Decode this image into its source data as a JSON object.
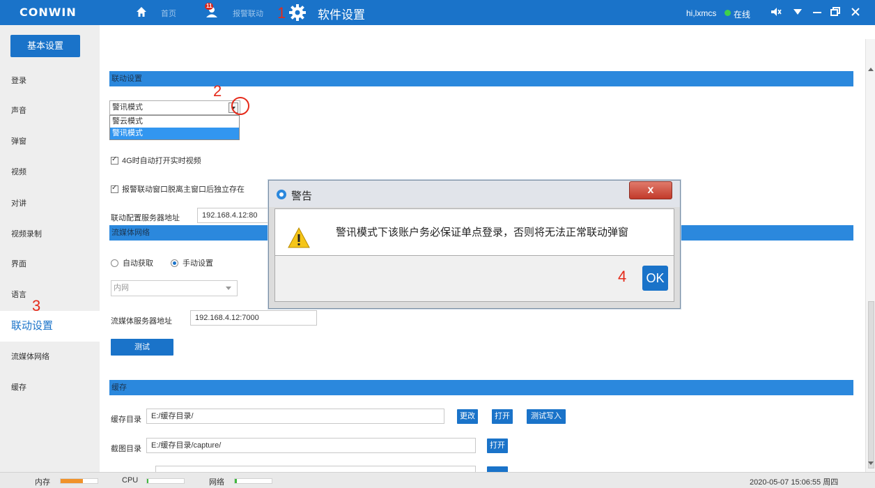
{
  "titlebar": {
    "logo": "CONWIN",
    "nav": {
      "home_label": "首页",
      "alarm_label": "报警联动",
      "alarm_badge": "11",
      "settings_label": "软件设置"
    },
    "user": "hi,lxmcs",
    "status": "在线"
  },
  "leftnav": {
    "basic_button": "基本设置",
    "items": [
      "登录",
      "声音",
      "弹窗",
      "视频",
      "对讲",
      "视频录制",
      "界面",
      "语言",
      "联动设置",
      "流媒体网络",
      "缓存"
    ],
    "active_index": 8
  },
  "linkage": {
    "section_title": "联动设置",
    "mode_select": "警讯模式",
    "mode_options": [
      "警云模式",
      "警讯模式"
    ],
    "selected_option": "警讯模式",
    "check_4g": "4G时自动打开实时视频",
    "check_detach": "报警联动窗口脱离主窗口后独立存在",
    "server_label": "联动配置服务器地址",
    "server_value": "192.168.4.12:80"
  },
  "streaming": {
    "section_title": "流媒体网络",
    "radio_auto": "自动获取",
    "radio_manual": "手动设置",
    "network_select": "内网",
    "server_label": "流媒体服务器地址",
    "server_value": "192.168.4.12:7000",
    "test_button": "测试"
  },
  "cache": {
    "section_title": "缓存",
    "dir_label": "缓存目录",
    "dir_value": "E:/缓存目录/",
    "change_button": "更改",
    "open_button": "打开",
    "test_write_button": "测试写入",
    "capture_label": "截图目录",
    "capture_value": "E:/缓存目录/capture/",
    "capture_open_button": "打开"
  },
  "dialog": {
    "title": "警告",
    "close_symbol": "x",
    "message": "警讯模式下该账户务必保证单点登录，否则将无法正常联动弹窗",
    "ok_button": "OK"
  },
  "annotations": {
    "a1": "1",
    "a2": "2",
    "a3": "3",
    "a4": "4"
  },
  "statusbar": {
    "memory_label": "内存",
    "cpu_label": "CPU",
    "network_label": "网络",
    "memory_level": 0.6,
    "cpu_level": 0.03,
    "network_level": 0.05,
    "datetime": "2020-05-07 15:06:55 周四"
  },
  "colors": {
    "accent": "#1a73c9",
    "section_bar": "#2b88dd",
    "annotation": "#e52a1a",
    "memory_fill": "#f0922a",
    "cpu_fill": "#3fb83f",
    "network_fill": "#3fb83f"
  }
}
